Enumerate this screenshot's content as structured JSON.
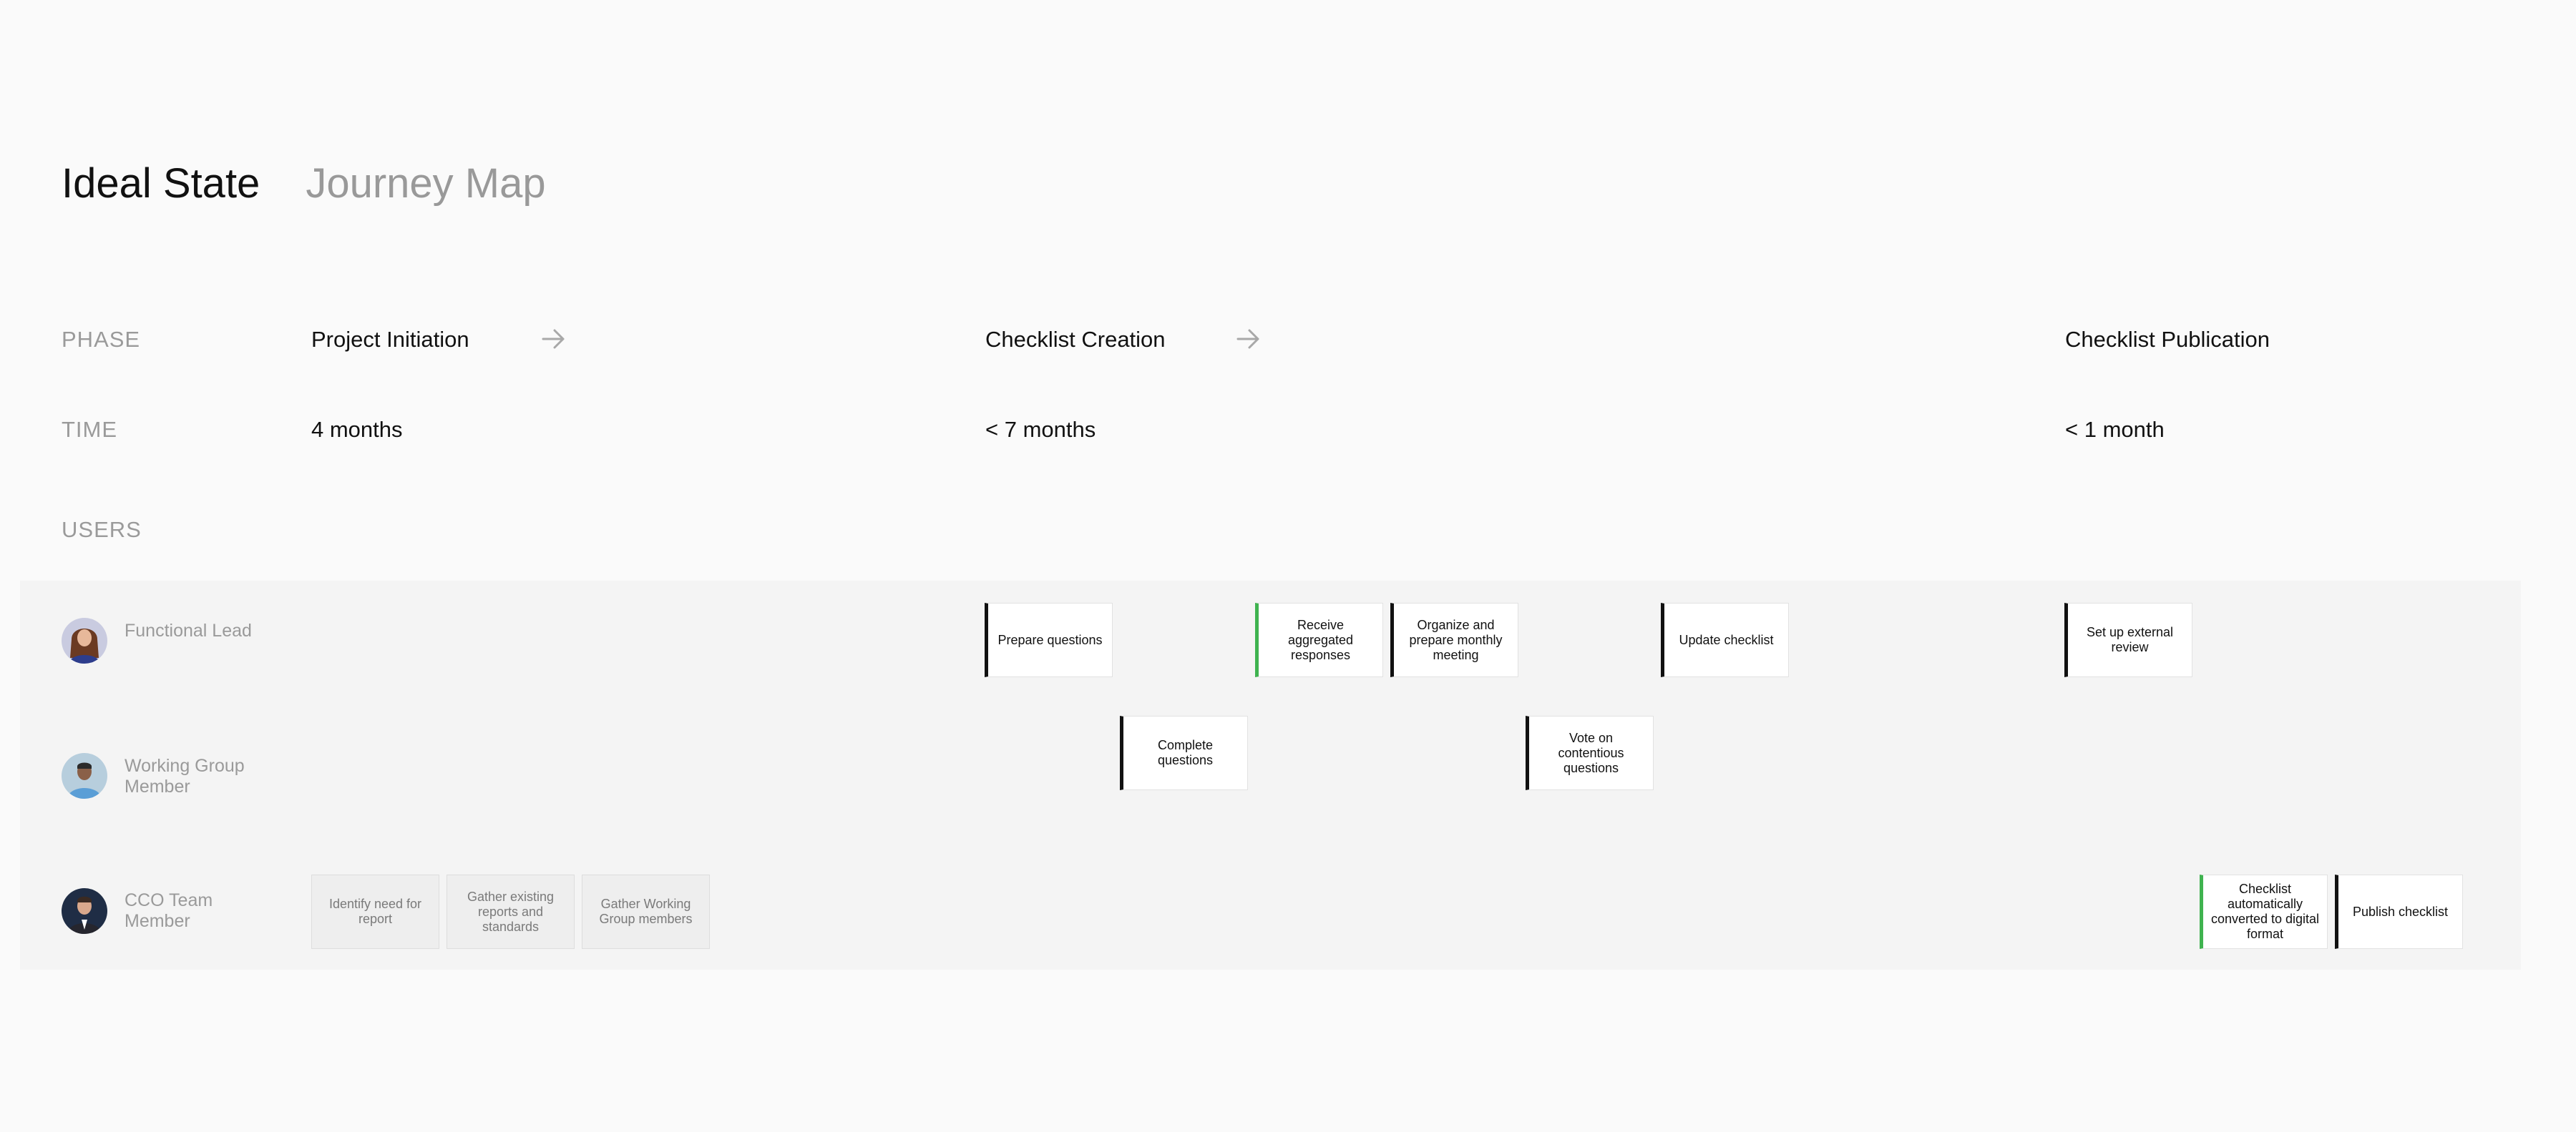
{
  "header": {
    "title": "Ideal State",
    "subtitle": "Journey Map"
  },
  "row_labels": {
    "phase": "PHASE",
    "time": "TIME",
    "users": "USERS"
  },
  "phases": [
    {
      "name": "Project Initiation",
      "time": "4 months",
      "arrow_icon": "arrow-right-icon"
    },
    {
      "name": "Checklist Creation",
      "time": "< 7 months",
      "arrow_icon": "arrow-right-icon"
    },
    {
      "name": "Checklist Publication",
      "time": "< 1 month"
    }
  ],
  "users": [
    {
      "name": "Functional Lead",
      "avatar_icon": "avatar-woman"
    },
    {
      "name": "Working Group Member",
      "avatar_icon": "avatar-man-blue-shirt"
    },
    {
      "name": "CCO Team Member",
      "avatar_icon": "avatar-man-suit"
    }
  ],
  "colors": {
    "background": "#fafafa",
    "lane_background": "#f4f4f4",
    "manual_step": "#111111",
    "automated_step": "#3fb34f",
    "past_step": "#eeeeee"
  },
  "steps": {
    "functional_lead": [
      {
        "label": "Prepare questions",
        "kind": "manual"
      },
      {
        "label": "Receive aggregated responses",
        "kind": "automated"
      },
      {
        "label": "Organize and prepare monthly meeting",
        "kind": "manual"
      },
      {
        "label": "Update checklist",
        "kind": "manual"
      },
      {
        "label": "Set up external review",
        "kind": "manual"
      }
    ],
    "working_group_member": [
      {
        "label": "Complete questions",
        "kind": "manual"
      },
      {
        "label": "Vote on contentious questions",
        "kind": "manual"
      }
    ],
    "cco_team_member": [
      {
        "label": "Identify need for report",
        "kind": "past"
      },
      {
        "label": "Gather existing reports and standards",
        "kind": "past"
      },
      {
        "label": "Gather Working Group members",
        "kind": "past"
      },
      {
        "label": "Checklist automatically converted to digital format",
        "kind": "automated"
      },
      {
        "label": "Publish checklist",
        "kind": "manual"
      }
    ]
  }
}
